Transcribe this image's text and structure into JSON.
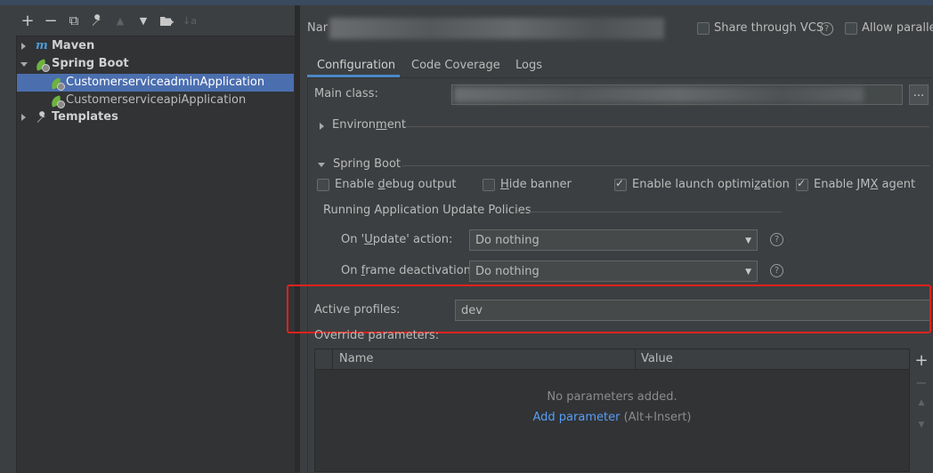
{
  "left_panel": {
    "toolbar": [
      {
        "name": "add-icon",
        "glyph": "+"
      },
      {
        "name": "remove-icon",
        "glyph": "−"
      },
      {
        "name": "copy-icon",
        "glyph": "⧉"
      },
      {
        "name": "wrench-icon",
        "glyph": "🔧"
      },
      {
        "name": "move-up-icon",
        "glyph": "▲"
      },
      {
        "name": "move-down-icon",
        "glyph": "▼"
      },
      {
        "name": "folder-icon",
        "glyph": "📁"
      },
      {
        "name": "sort-icon",
        "glyph": "↓"
      }
    ],
    "tree": {
      "maven": "Maven",
      "spring_boot": "Spring Boot",
      "app_admin": "CustomerserviceadminApplication",
      "app_api": "CustomerserviceapiApplication",
      "templates": "Templates"
    }
  },
  "header": {
    "name_label": "Nar",
    "share_vcs": "Share through VCS",
    "allow_parallel": "Allow paralle"
  },
  "tabs": [
    "Configuration",
    "Code Coverage",
    "Logs"
  ],
  "main_class": {
    "label": "Main class:",
    "browse": "..."
  },
  "environment": {
    "pre": "Environ",
    "mn": "m",
    "post": "ent"
  },
  "spring_boot_section": {
    "title": "Spring Boot",
    "enable_debug_output": {
      "pre": "Enable ",
      "mn": "d",
      "post": "ebug output",
      "checked": false
    },
    "hide_banner": {
      "pre": "",
      "mn": "H",
      "post": "ide banner",
      "checked": false
    },
    "enable_launch_optimization": {
      "pre": "Enable launch optimi",
      "mn": "z",
      "post": "ation",
      "checked": true
    },
    "enable_jmx_agent": {
      "pre": "Enable JM",
      "mn": "X",
      "post": " agent",
      "checked": true
    }
  },
  "update_policies": {
    "title": "Running Application Update Policies",
    "on_update": {
      "pre": "On '",
      "mn": "U",
      "post": "pdate' action:",
      "value": "Do nothing"
    },
    "on_frame": {
      "pre": "On ",
      "mn": "f",
      "post": "rame deactivation:",
      "value": "Do nothing"
    }
  },
  "active_profiles": {
    "label": "Active profiles:",
    "value": "dev"
  },
  "override": {
    "label": "Override parameters:",
    "columns": [
      "Name",
      "Value"
    ],
    "empty_text": "No parameters added.",
    "add_link": "Add parameter",
    "add_hint": "(Alt+Insert)"
  },
  "colors": {
    "accent": "#4a88c7",
    "selection": "#4b6eaf",
    "highlight_box": "#e0221b",
    "link": "#589df6",
    "spring_green": "#6db33f"
  }
}
